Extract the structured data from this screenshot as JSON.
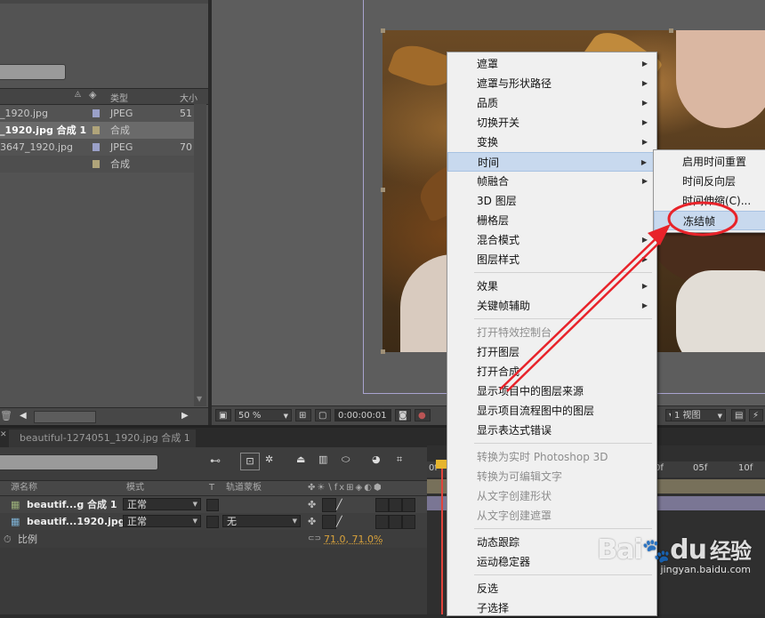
{
  "project": {
    "columns": {
      "type": "类型",
      "size": "大小"
    },
    "items": [
      {
        "name": "_1920.jpg",
        "type": "JPEG",
        "size": "51",
        "swatch": "#9aa0c8"
      },
      {
        "name": "_1920.jpg 合成 1",
        "type": "合成",
        "size": "",
        "swatch": "#b0a47a",
        "selected": true
      },
      {
        "name": "3647_1920.jpg",
        "type": "JPEG",
        "size": "70",
        "swatch": "#9aa0c8"
      },
      {
        "name": "",
        "type": "合成",
        "size": "",
        "swatch": "#b0a47a"
      }
    ]
  },
  "viewer": {
    "zoom": "50 %",
    "timecode": "0:00:00:01",
    "view_count": "1 视图"
  },
  "timeline": {
    "tab_label": "beautiful-1274051_1920.jpg 合成 1",
    "columns": {
      "source": "源名称",
      "mode": "模式",
      "t": "T",
      "trkmat": "轨道蒙板"
    },
    "layers": [
      {
        "name": "beautif...g 合成 1",
        "mode": "正常",
        "trkmat": ""
      },
      {
        "name": "beautif...1920.jpg",
        "mode": "正常",
        "trkmat": "无"
      }
    ],
    "scale_label": "比例",
    "scale_value": "71.0, 71.0%",
    "ruler": [
      "0f",
      "05f",
      "10f"
    ]
  },
  "context_menu": {
    "items": [
      {
        "label": "遮罩",
        "sub": true
      },
      {
        "label": "遮罩与形状路径",
        "sub": true
      },
      {
        "label": "品质",
        "sub": true
      },
      {
        "label": "切换开关",
        "sub": true
      },
      {
        "label": "变换",
        "sub": true
      },
      {
        "label": "时间",
        "sub": true,
        "highlight": true
      },
      {
        "label": "帧融合",
        "sub": true
      },
      {
        "label": "3D 图层"
      },
      {
        "label": "栅格层"
      },
      {
        "label": "混合模式",
        "sub": true
      },
      {
        "label": "图层样式",
        "sub": true
      },
      {
        "label": "效果",
        "sub": true
      },
      {
        "label": "关键帧辅助",
        "sub": true
      },
      {
        "label": "打开特效控制台",
        "disabled": true
      },
      {
        "label": "打开图层"
      },
      {
        "label": "打开合成"
      },
      {
        "label": "显示项目中的图层来源"
      },
      {
        "label": "显示项目流程图中的图层"
      },
      {
        "label": "显示表达式错误"
      },
      {
        "label": "转换为实时 Photoshop 3D",
        "disabled": true
      },
      {
        "label": "转换为可编辑文字",
        "disabled": true
      },
      {
        "label": "从文字创建形状",
        "disabled": true
      },
      {
        "label": "从文字创建遮罩",
        "disabled": true
      },
      {
        "label": "动态跟踪"
      },
      {
        "label": "运动稳定器"
      },
      {
        "label": "反选"
      },
      {
        "label": "子选择"
      }
    ]
  },
  "submenu": {
    "items": [
      {
        "label": "启用时间重置"
      },
      {
        "label": "时间反向层"
      },
      {
        "label": "时间伸缩(C)..."
      },
      {
        "label": "冻结帧",
        "highlight": true
      }
    ]
  },
  "annotation_color": "#e8232a",
  "watermark": {
    "brand": "Bai",
    "brand2": "du",
    "cn": "经验",
    "url": "jingyan.baidu.com"
  }
}
